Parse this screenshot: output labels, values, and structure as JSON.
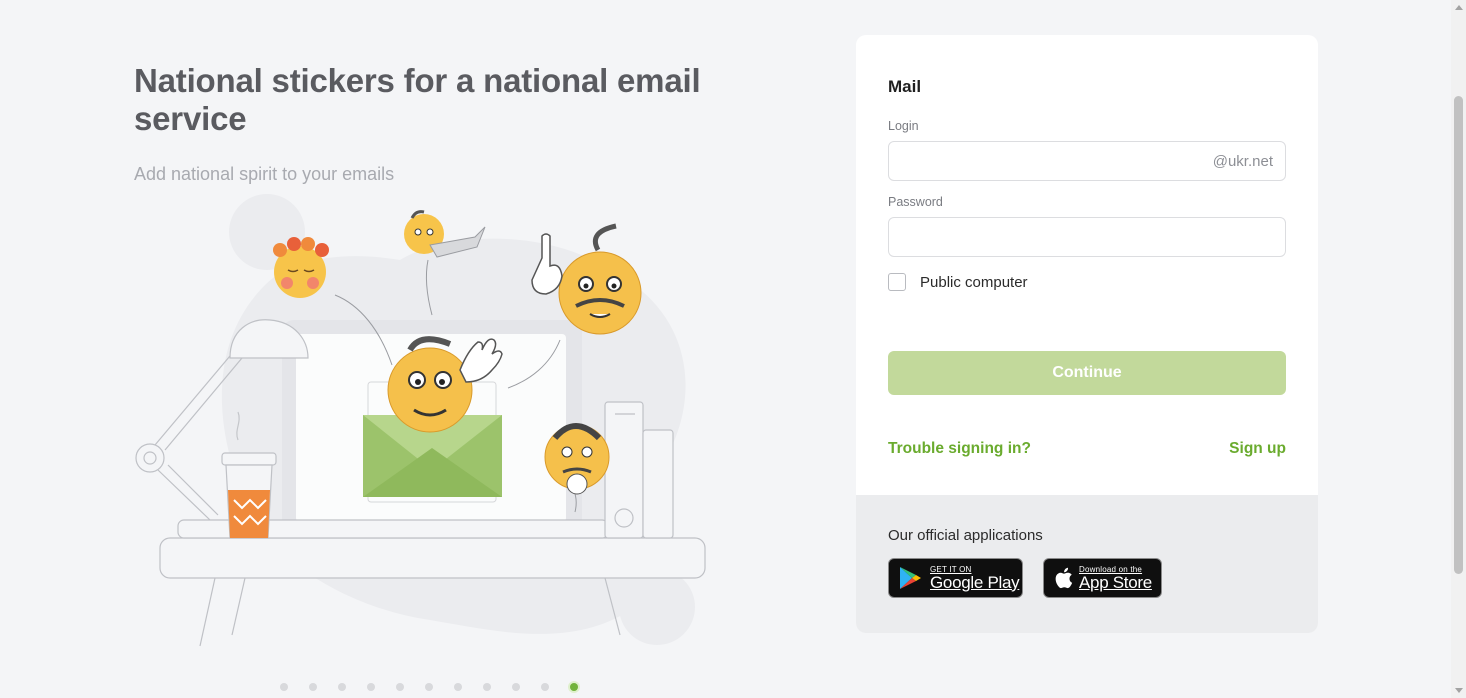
{
  "promo": {
    "title": "National stickers for a national email service",
    "subtitle": "Add national spirit to your emails",
    "slide_count": 11,
    "active_slide": 11
  },
  "login_card": {
    "title": "Mail",
    "login_label": "Login",
    "login_value": "",
    "login_suffix": "@ukr.net",
    "password_label": "Password",
    "password_value": "",
    "public_computer_label": "Public computer",
    "public_computer_checked": false,
    "continue_label": "Continue",
    "trouble_link": "Trouble signing in?",
    "signup_link": "Sign up"
  },
  "apps": {
    "title": "Our official applications",
    "google_play": {
      "small": "GET IT ON",
      "big": "Google Play"
    },
    "app_store": {
      "small": "Download on the",
      "big": "App Store"
    }
  },
  "colors": {
    "accent": "#6aab2e",
    "button_disabled": "#c2d99b",
    "envelope_green": "#9cc36b",
    "cup_orange": "#f08a3c"
  }
}
